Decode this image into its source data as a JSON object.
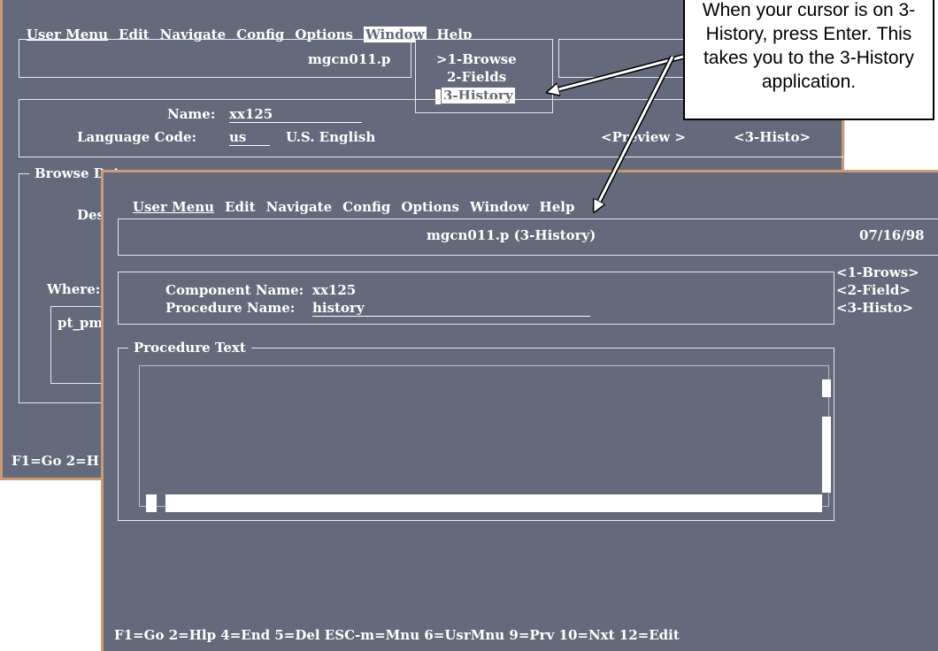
{
  "callout": {
    "text": "When your cursor is on 3-History, press Enter.  This takes you to the 3-History application."
  },
  "back_window": {
    "menu": [
      "User Menu",
      "Edit",
      "Navigate",
      "Config",
      "Options",
      "Window",
      "Help"
    ],
    "program": "mgcn011.p",
    "dropdown": {
      "items": [
        ">1-Browse",
        "2-Fields",
        "3-History"
      ]
    },
    "name_label": "Name:",
    "name_value": "xx125",
    "lang_label": "Language Code:",
    "lang_value": "us",
    "lang_desc": "U.S. English",
    "preview": "<Preview >",
    "histo": "<3-Histo>",
    "browse_legend": "Browse Data",
    "des_label": "Des",
    "where_label": "Where:",
    "pt_label": "pt_pm",
    "fkeys": "F1=Go 2=H"
  },
  "front_window": {
    "menu": [
      "User Menu",
      "Edit",
      "Navigate",
      "Config",
      "Options",
      "Window",
      "Help"
    ],
    "title": "mgcn011.p (3-History)",
    "date": "07/16/98",
    "side_links": [
      "<1-Brows>",
      "<2-Field>",
      "<3-Histo>"
    ],
    "component_label": "Component Name:",
    "component_value": "xx125",
    "procedure_label": "Procedure Name:",
    "procedure_value": "history",
    "text_legend": "Procedure Text",
    "fkeys": "F1=Go 2=Hlp 4=End 5=Del ESC-m=Mnu 6=UsrMnu 9=Prv 10=Nxt 12=Edit"
  },
  "colors": {
    "terminal_bg": "#646a7c",
    "frame": "#c99a74",
    "text": "#ffffff"
  }
}
